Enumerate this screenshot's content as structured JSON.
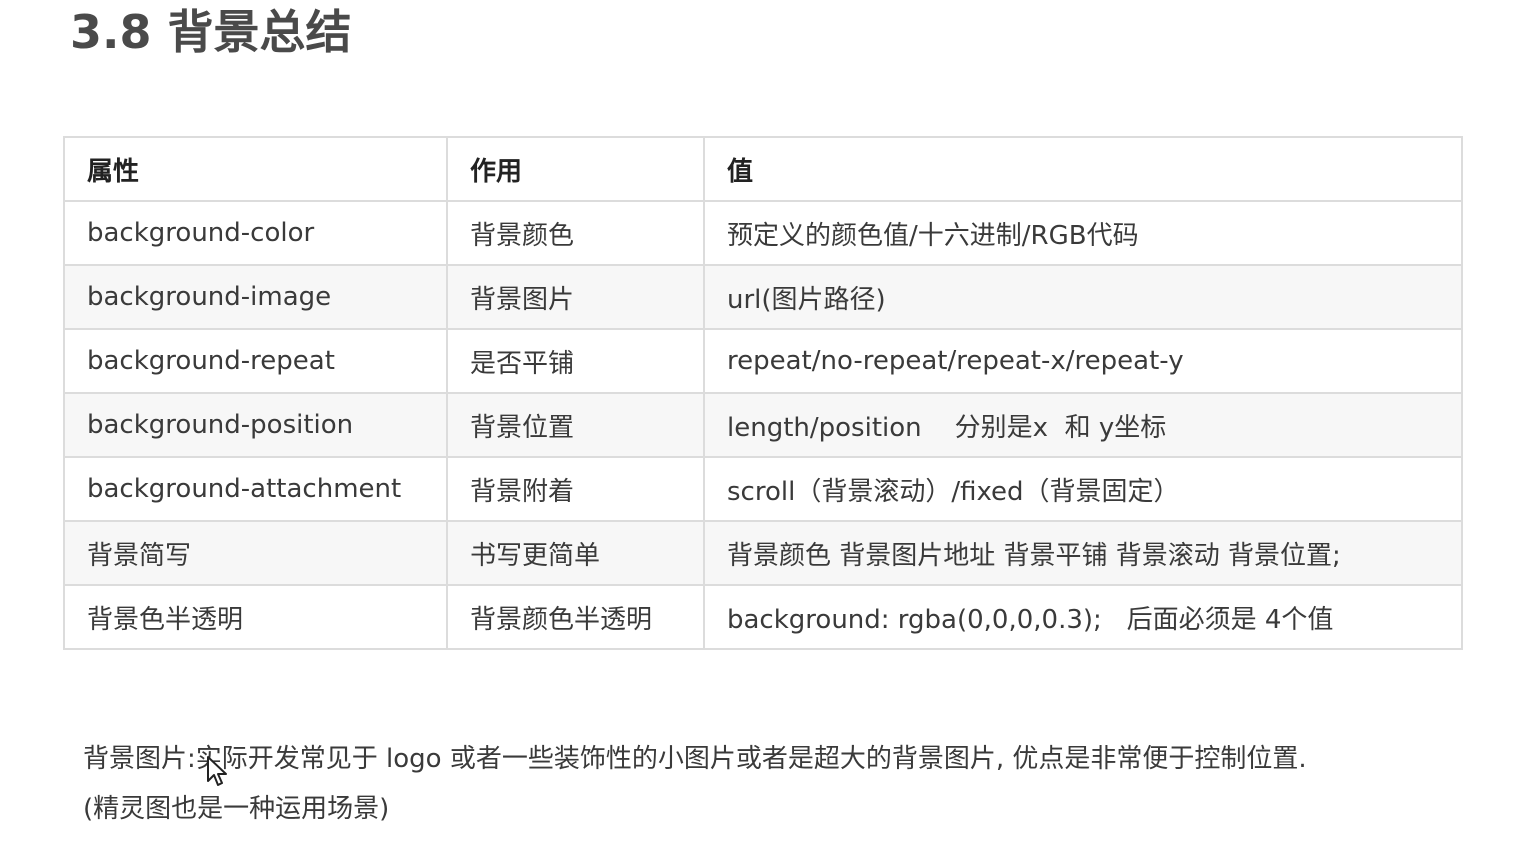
{
  "page": {
    "title": "3.8 背景总结"
  },
  "table": {
    "headers": [
      "属性",
      "作用",
      "值"
    ],
    "rows": [
      [
        "background-color",
        "背景颜色",
        "预定义的颜色值/十六进制/RGB代码"
      ],
      [
        "background-image",
        "背景图片",
        "url(图片路径)"
      ],
      [
        "background-repeat",
        "是否平铺",
        "repeat/no-repeat/repeat-x/repeat-y"
      ],
      [
        "background-position",
        "背景位置",
        "length/position    分别是x  和 y坐标"
      ],
      [
        "background-attachment",
        "背景附着",
        "scroll（背景滚动）/fixed（背景固定）"
      ],
      [
        "背景简写",
        "书写更简单",
        "背景颜色 背景图片地址 背景平铺 背景滚动 背景位置;"
      ],
      [
        "背景色半透明",
        "背景颜色半透明",
        "background: rgba(0,0,0,0.3);   后面必须是 4个值"
      ]
    ]
  },
  "note": {
    "line1": "背景图片:实际开发常见于 logo 或者一些装饰性的小图片或者是超大的背景图片, 优点是非常便于控制位置.",
    "line2": "(精灵图也是一种运用场景)"
  },
  "icons": {
    "cursor": "mouse-pointer-icon"
  },
  "colors": {
    "title": "#4a4a4a",
    "border": "#dcdcdc",
    "row_stripe": "#f7f7f7",
    "text": "#3a3a3a"
  }
}
